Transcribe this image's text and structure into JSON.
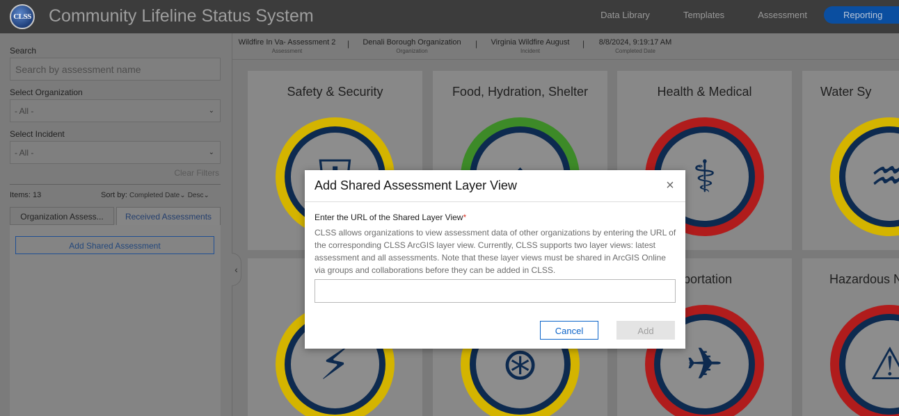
{
  "header": {
    "logo_text": "CLSS",
    "app_title": "Community Lifeline Status System",
    "nav": [
      "Data Library",
      "Templates",
      "Assessment",
      "Reporting"
    ],
    "active_nav": "Reporting"
  },
  "sidebar": {
    "search_label": "Search",
    "search_placeholder": "Search by assessment name",
    "org_label": "Select Organization",
    "org_value": "- All -",
    "incident_label": "Select Incident",
    "incident_value": "- All -",
    "clear_filters": "Clear Filters",
    "items_count": "Items: 13",
    "sort_label": "Sort by:",
    "sort_field": "Completed Date",
    "sort_order": "Desc",
    "tabs": [
      "Organization Assess...",
      "Received Assessments"
    ],
    "add_shared_button": "Add Shared Assessment"
  },
  "infobar": {
    "assessment_value": "Wildfire In Va- Assessment 2",
    "assessment_key": "Assessment",
    "organization_value": "Denali Borough Organization",
    "organization_key": "Organization",
    "incident_value": "Virginia Wildfire August",
    "incident_key": "Incident",
    "date_value": "8/8/2024, 9:19:17 AM",
    "date_key": "Completed Date"
  },
  "cards": [
    {
      "title": "Safety & Security",
      "status_color": "#d4b400",
      "icon": "police-badge-icon"
    },
    {
      "title": "Food, Hydration, Shelter",
      "status_color": "#3d8a28",
      "icon": "food-shelter-icon"
    },
    {
      "title": "Health & Medical",
      "status_color": "#b01c1c",
      "icon": "caduceus-icon"
    },
    {
      "title": "Water Sy",
      "status_color": "#d4b400",
      "icon": "water-faucet-icon"
    },
    {
      "title": "",
      "status_color": "#d4b400",
      "icon": "energy-fuel-icon"
    },
    {
      "title": "",
      "status_color": "#d4b400",
      "icon": "communications-tower-icon"
    },
    {
      "title": "sportation",
      "status_color": "#b01c1c",
      "icon": "transportation-icon"
    },
    {
      "title": "Hazardous N",
      "status_color": "#b01c1c",
      "icon": "hazmat-barrel-icon"
    }
  ],
  "modal": {
    "title": "Add Shared Assessment Layer View",
    "field_label": "Enter the URL of the Shared Layer View",
    "required_mark": "*",
    "description": "CLSS allows organizations to view assessment data of other organizations by entering the URL of the corresponding CLSS ArcGIS layer view. Currently, CLSS supports two layer views: latest assessment and all assessments. Note that these layer views must be shared in ArcGIS Online via groups and collaborations before they can be added in CLSS.",
    "url_value": "",
    "cancel_label": "Cancel",
    "add_label": "Add"
  }
}
